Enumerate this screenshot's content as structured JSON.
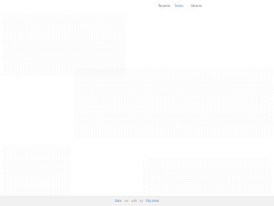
{
  "nav": {
    "items": [
      {
        "label": "Tanzania",
        "active": false
      },
      {
        "label": "Serbia",
        "active": true
      },
      {
        "label": "Ukraine",
        "active": false
      }
    ]
  },
  "footer": {
    "part1": "Data",
    "part2": "set",
    "part3": "with",
    "part4": "by",
    "link": "Filip Haitz"
  },
  "colors": {
    "accent": "#3b86c4",
    "footer_bg": "#f1f1f1",
    "text": "#5a5a5a"
  }
}
